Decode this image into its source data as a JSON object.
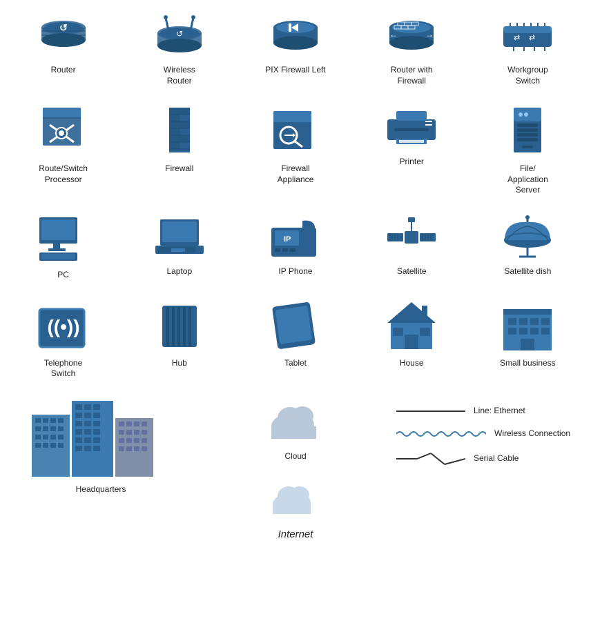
{
  "icons": {
    "row1": [
      {
        "name": "router",
        "label": "Router"
      },
      {
        "name": "wireless-router",
        "label": "Wireless\nRouter"
      },
      {
        "name": "pix-firewall",
        "label": "PIX Firewall Left"
      },
      {
        "name": "router-firewall",
        "label": "Router with\nFirewall"
      },
      {
        "name": "workgroup-switch",
        "label": "Workgroup\nSwitch"
      }
    ],
    "row2": [
      {
        "name": "route-switch-processor",
        "label": "Route/Switch\nProcessor"
      },
      {
        "name": "firewall",
        "label": "Firewall"
      },
      {
        "name": "firewall-appliance",
        "label": "Firewall\nAppliance"
      },
      {
        "name": "printer",
        "label": "Printer"
      },
      {
        "name": "file-server",
        "label": "File/\nApplication\nServer"
      }
    ],
    "row3": [
      {
        "name": "pc",
        "label": "PC"
      },
      {
        "name": "laptop",
        "label": "Laptop"
      },
      {
        "name": "ip-phone",
        "label": "IP Phone"
      },
      {
        "name": "satellite",
        "label": "Satellite"
      },
      {
        "name": "satellite-dish",
        "label": "Satellite dish"
      }
    ],
    "row4": [
      {
        "name": "telephone-switch",
        "label": "Telephone\nSwitch"
      },
      {
        "name": "hub",
        "label": "Hub"
      },
      {
        "name": "tablet",
        "label": "Tablet"
      },
      {
        "name": "house",
        "label": "House"
      },
      {
        "name": "small-business",
        "label": "Small business"
      }
    ]
  },
  "legend": {
    "ethernet_label": "Line: Ethernet",
    "wireless_label": "Wireless Connection",
    "serial_label": "Serial Cable",
    "cloud_label": "Cloud",
    "internet_label": "Internet",
    "headquarters_label": "Headquarters"
  }
}
